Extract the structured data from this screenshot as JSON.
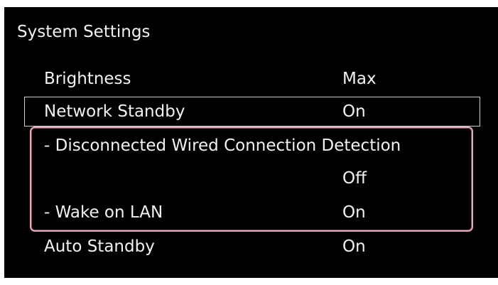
{
  "screen": {
    "title": "System Settings",
    "rows": [
      {
        "label": "Brightness",
        "value": "Max"
      },
      {
        "label": "Network Standby",
        "value": "On"
      },
      {
        "label": "- Disconnected Wired Connection Detection",
        "value": ""
      },
      {
        "label": "",
        "value": "Off"
      },
      {
        "label": "- Wake on LAN",
        "value": "On"
      },
      {
        "label": "Auto Standby",
        "value": "On"
      }
    ]
  },
  "colors": {
    "background": "#000000",
    "text": "#f2f2f2",
    "focus_border": "#cfcfcf",
    "highlight_border": "#e6a9c3"
  }
}
